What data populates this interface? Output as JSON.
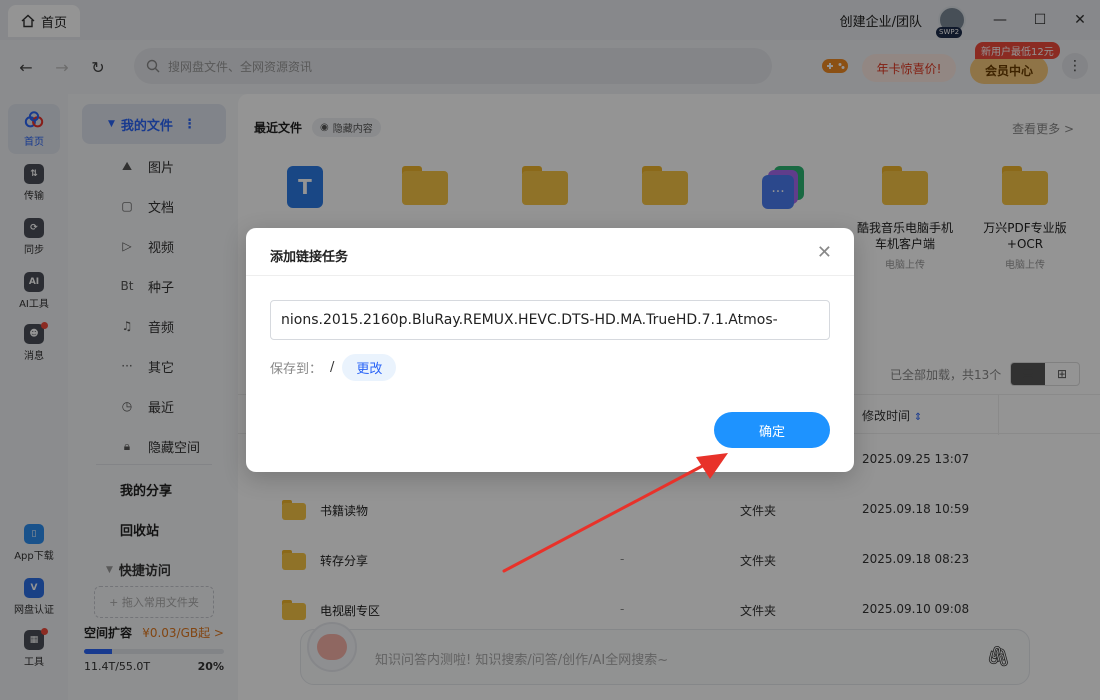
{
  "titlebar": {
    "home_tab": "首页",
    "create_team": "创建企业/团队",
    "avatar_badge": "SWP2"
  },
  "navbar": {
    "search_placeholder": "搜网盘文件、全网资源资讯",
    "promo_label": "年卡惊喜价!",
    "vip_label": "会员中心",
    "vip_badge": "新用户最低12元"
  },
  "rail": {
    "items": [
      {
        "label": "首页",
        "icon": "home-cloud-icon"
      },
      {
        "label": "传输",
        "icon": "transfer-icon"
      },
      {
        "label": "同步",
        "icon": "sync-icon"
      },
      {
        "label": "AI工具",
        "icon": "ai-tools-icon"
      },
      {
        "label": "消息",
        "icon": "message-icon"
      },
      {
        "label": "App下载",
        "icon": "app-download-icon"
      },
      {
        "label": "网盘认证",
        "icon": "verify-icon"
      },
      {
        "label": "工具",
        "icon": "tools-icon"
      }
    ]
  },
  "sidebar": {
    "my_files": "我的文件",
    "items": [
      {
        "label": "图片",
        "icon": "image-icon"
      },
      {
        "label": "文档",
        "icon": "document-icon"
      },
      {
        "label": "视频",
        "icon": "video-icon"
      },
      {
        "label": "种子",
        "icon": "torrent-icon"
      },
      {
        "label": "音频",
        "icon": "audio-icon"
      },
      {
        "label": "其它",
        "icon": "other-icon"
      },
      {
        "label": "最近",
        "icon": "recent-icon"
      },
      {
        "label": "隐藏空间",
        "icon": "lock-icon"
      }
    ],
    "my_share": "我的分享",
    "recycle": "回收站",
    "quick_access": "快捷访问",
    "drag_hint": "+ 拖入常用文件夹",
    "expand_title": "空间扩容",
    "expand_price": "¥0.03/GB起 >",
    "usage": "11.4T/55.0T",
    "usage_percent": "20%",
    "usage_fraction": 0.2
  },
  "main": {
    "recent_title": "最近文件",
    "hide_content": "隐藏内容",
    "view_more": "查看更多 >",
    "recent_cards": [
      {
        "kind": "doc",
        "name": "",
        "sub": ""
      },
      {
        "kind": "folder",
        "name": "",
        "sub": ""
      },
      {
        "kind": "folder",
        "name": "",
        "sub": ""
      },
      {
        "kind": "folder",
        "name": "",
        "sub": ""
      },
      {
        "kind": "chat",
        "name": "",
        "sub": ""
      },
      {
        "kind": "folder",
        "name": "酷我音乐电脑手机车机客户端",
        "sub": "电脑上传"
      },
      {
        "kind": "folder",
        "name": "万兴PDF专业版+OCR",
        "sub": "电脑上传"
      }
    ],
    "list_info": "已全部加载，共13个",
    "mtime_header": "修改时间",
    "rows": [
      {
        "name": "",
        "size": "",
        "type": "",
        "time": "2025.09.25 13:07"
      },
      {
        "name": "书籍读物",
        "size": "",
        "type": "文件夹",
        "time": "2025.09.18 10:59"
      },
      {
        "name": "转存分享",
        "size": "-",
        "type": "文件夹",
        "time": "2025.09.18 08:23"
      },
      {
        "name": "电视剧专区",
        "size": "-",
        "type": "文件夹",
        "time": "2025.09.10 09:08"
      }
    ],
    "ask_placeholder": "知识问答内测啦! 知识搜索/问答/创作/AI全网搜索~"
  },
  "modal": {
    "title": "添加链接任务",
    "link_value": "nions.2015.2160p.BluRay.REMUX.HEVC.DTS-HD.MA.TrueHD.7.1.Atmos-",
    "save_to_label": "保存到：",
    "save_path": "/",
    "change_label": "更改",
    "confirm_label": "确定"
  },
  "colors": {
    "accent": "#1e93ff",
    "brand_blue": "#2a64f6",
    "arrow_red": "#e8322a"
  }
}
